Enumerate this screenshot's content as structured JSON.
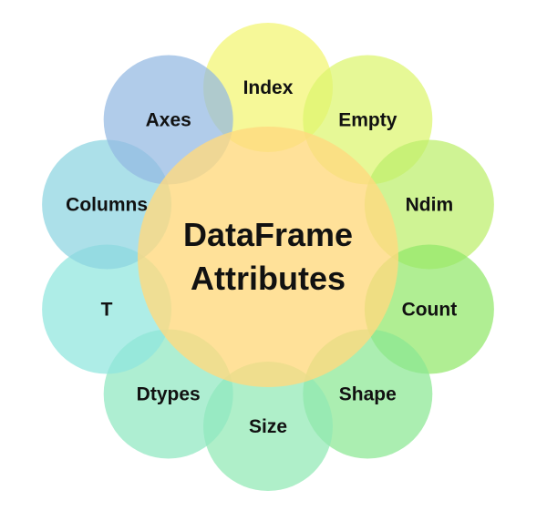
{
  "diagram": {
    "center": {
      "line1": "DataFrame",
      "line2": "Attributes",
      "color": "#FFD980"
    },
    "items": [
      {
        "label": "Index",
        "color": "#F3F570"
      },
      {
        "label": "Empty",
        "color": "#DDF56E"
      },
      {
        "label": "Ndim",
        "color": "#BDEE6B"
      },
      {
        "label": "Count",
        "color": "#92E86A"
      },
      {
        "label": "Shape",
        "color": "#8BE893"
      },
      {
        "label": "Size",
        "color": "#90E9B4"
      },
      {
        "label": "Dtypes",
        "color": "#8FE8C1"
      },
      {
        "label": "T",
        "color": "#8FE6DE"
      },
      {
        "label": "Columns",
        "color": "#8CD4E1"
      },
      {
        "label": "Axes",
        "color": "#93B9E2"
      }
    ]
  }
}
